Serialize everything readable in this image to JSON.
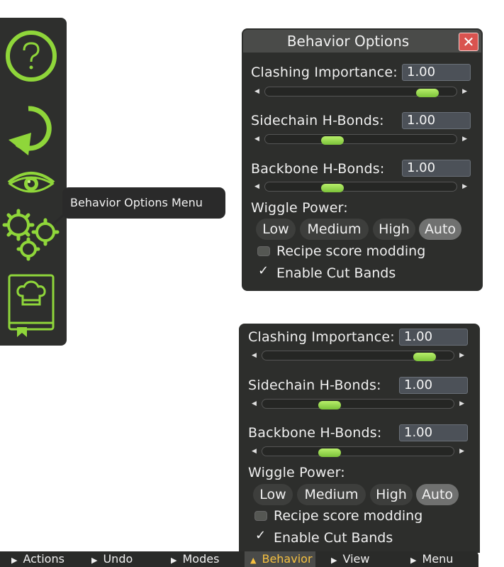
{
  "toolbar": {
    "icons": [
      "help-icon",
      "undo-icon",
      "view-eye-icon",
      "behavior-gears-icon",
      "recipe-book-icon"
    ]
  },
  "tooltip": {
    "text": "Behavior Options Menu"
  },
  "behavior_panel": {
    "title": "Behavior Options",
    "close_label": "✕",
    "clashing_label": "Clashing Importance:",
    "clashing_value": "1.00",
    "clashing_level": 0.9,
    "sidechain_label": "Sidechain H-Bonds:",
    "sidechain_value": "1.00",
    "sidechain_level": 0.33,
    "backbone_label": "Backbone H-Bonds:",
    "backbone_value": "1.00",
    "backbone_level": 0.33,
    "wiggle_label": "Wiggle Power:",
    "wiggle_options": [
      "Low",
      "Medium",
      "High",
      "Auto"
    ],
    "wiggle_selected": "Auto",
    "recipe_label": "Recipe score modding",
    "recipe_checked": false,
    "cutbands_label": "Enable Cut Bands",
    "cutbands_checked": true
  },
  "behavior_panel_copy": {
    "clashing_label": "Clashing Importance:",
    "clashing_value": "1.00",
    "sidechain_label": "Sidechain H-Bonds:",
    "sidechain_value": "1.00",
    "backbone_label": "Backbone H-Bonds:",
    "backbone_value": "1.00",
    "wiggle_label": "Wiggle Power:",
    "wiggle_options": [
      "Low",
      "Medium",
      "High",
      "Auto"
    ],
    "recipe_label": "Recipe score modding",
    "cutbands_label": "Enable Cut Bands"
  },
  "menu": {
    "items": [
      "Actions",
      "Undo",
      "Modes",
      "Behavior",
      "View",
      "Menu"
    ],
    "active": "Behavior",
    "collapsed_glyph": "▶",
    "expanded_glyph": "▲"
  },
  "colors": {
    "accent_green": "#8fd63a",
    "panel_bg": "#2d2e2c",
    "active_menu_text": "#f5c040",
    "close_red": "#d9534f"
  }
}
